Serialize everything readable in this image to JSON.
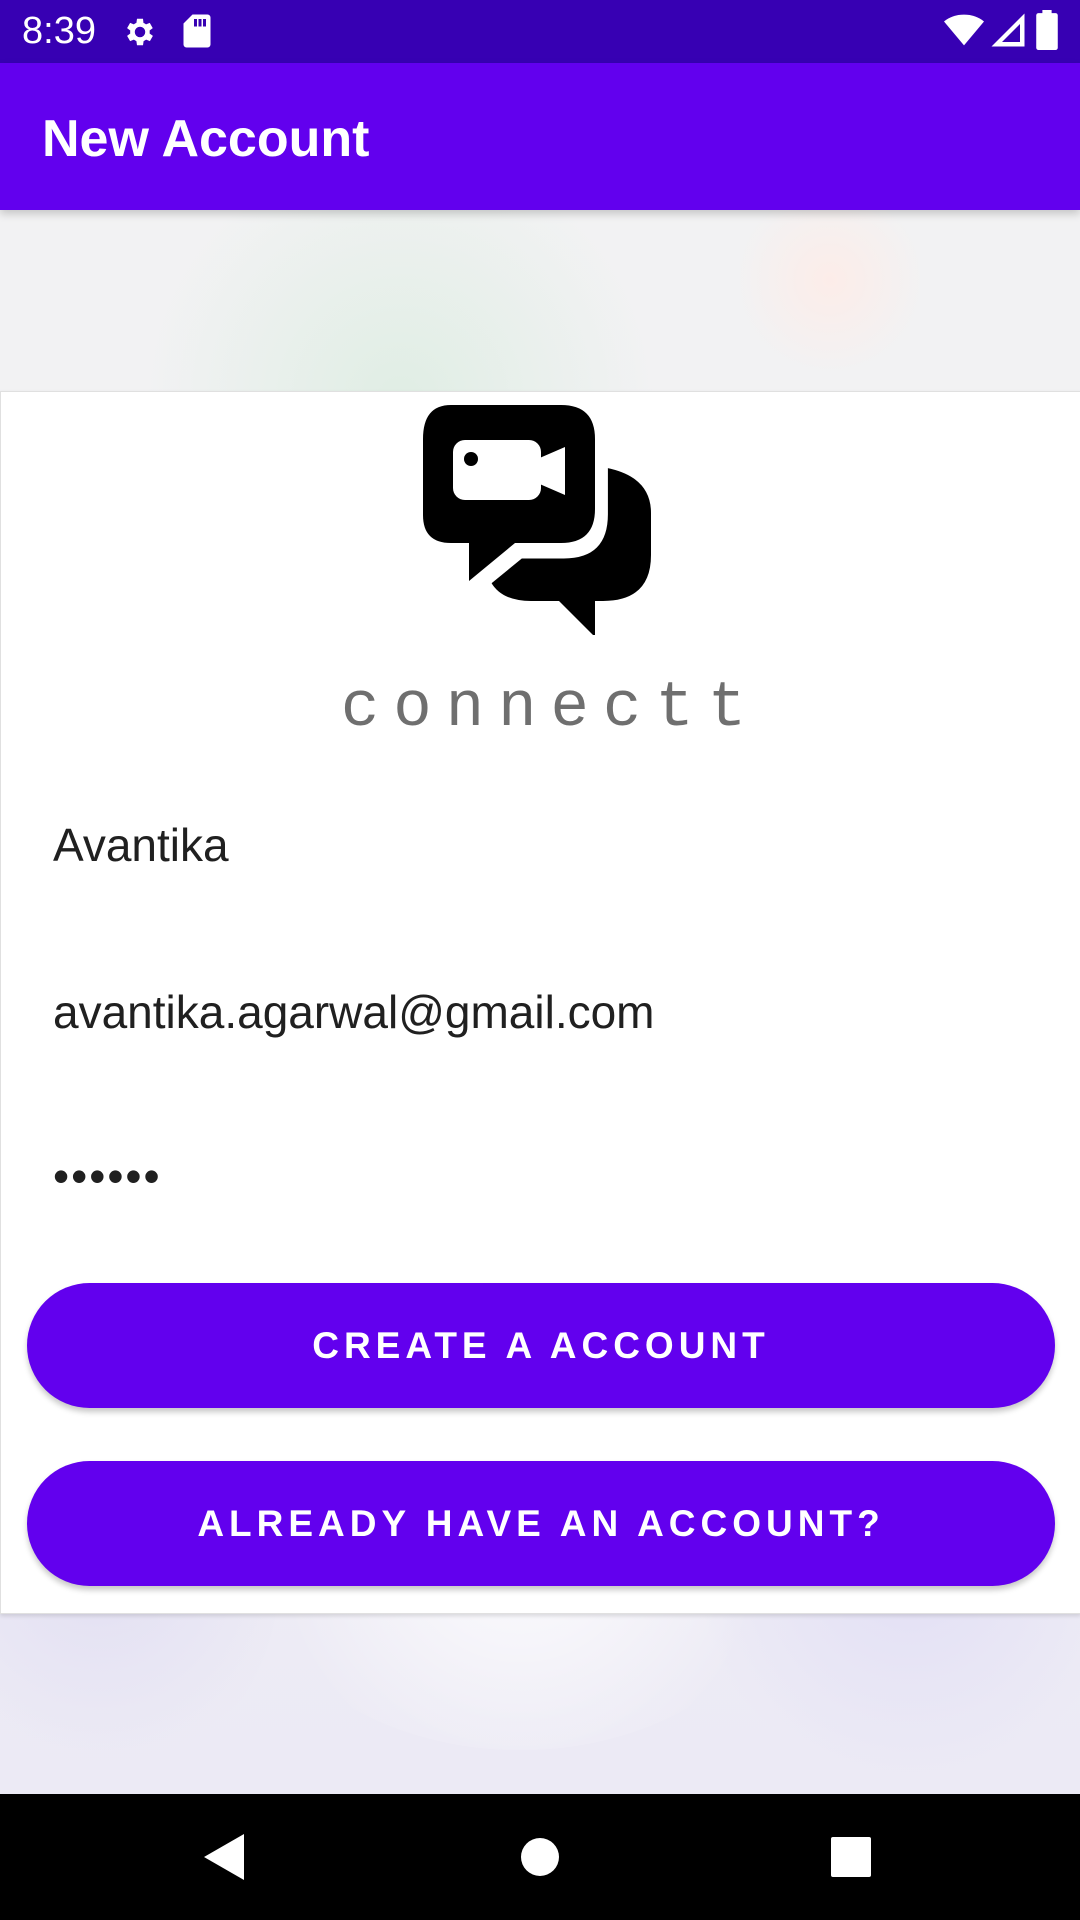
{
  "status_bar": {
    "time": "8:39",
    "icons": [
      "gear-icon",
      "sd-card-icon",
      "wifi-icon",
      "signal-icon",
      "battery-icon"
    ],
    "background": "#3700b3"
  },
  "app_bar": {
    "title": "New Account",
    "background": "#6200ee"
  },
  "logo": {
    "icon": "video-chat-bubbles-icon",
    "text": "connectt"
  },
  "form": {
    "name_value": "Avantika",
    "email_value": "avantika.agarwal@gmail.com",
    "password_value": "••••••"
  },
  "buttons": {
    "create_label": "CREATE A ACCOUNT",
    "login_label": "ALREADY HAVE AN ACCOUNT?",
    "color": "#6200ee"
  },
  "nav_bar": {
    "icons": [
      "back-icon",
      "home-icon",
      "recents-icon"
    ]
  }
}
